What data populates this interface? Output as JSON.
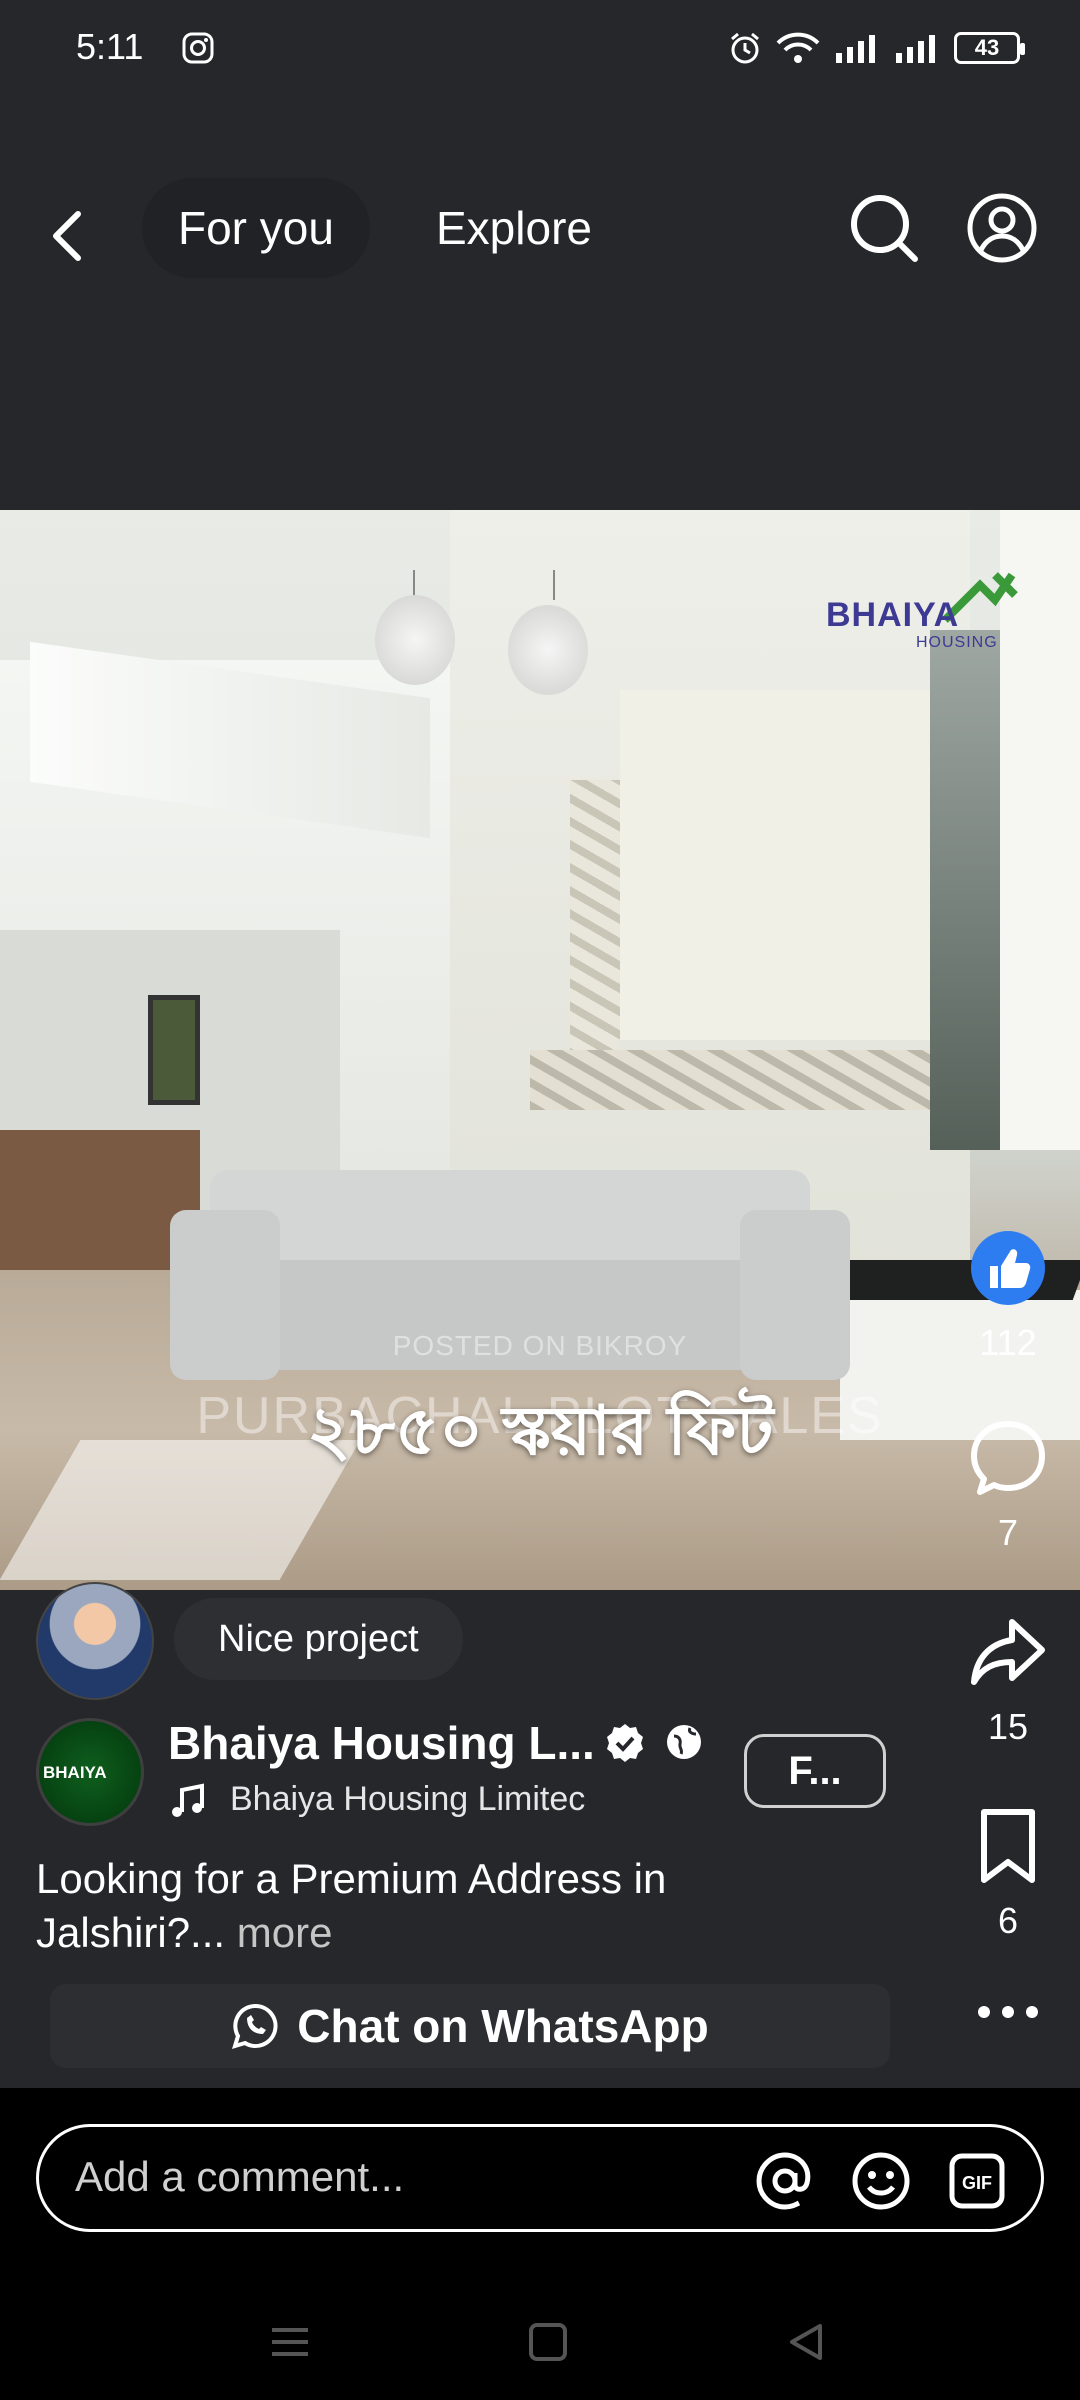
{
  "status_bar": {
    "time": "5:11",
    "battery": "43",
    "icons": [
      "instagram-icon",
      "alarm-icon",
      "wifi-icon",
      "signal-icon",
      "signal-icon",
      "battery-icon"
    ]
  },
  "nav": {
    "tabs": [
      {
        "label": "For you",
        "active": true
      },
      {
        "label": "Explore",
        "active": false
      }
    ],
    "icons": [
      "back-arrow-icon",
      "search-icon",
      "profile-icon"
    ]
  },
  "video": {
    "brand_logo": "BHAIYA",
    "brand_sub": "HOUSING",
    "watermark": "POSTED ON BIKROY",
    "caption_bn": "২৮৫০ স্কয়ার ফিট",
    "overlay_text": "PURBACHAL PLOT SALES"
  },
  "actions": {
    "likes": "112",
    "comments": "7",
    "shares": "15",
    "saves": "6"
  },
  "top_comment": "Nice project",
  "account": {
    "name": "Bhaiya Housing L...",
    "music": "Bhaiya Housing Limitec",
    "follow_label": "F...",
    "avatar_text": "BHAIYA"
  },
  "description": {
    "text": "Looking for a Premium Address in Jalshiri?...",
    "more": "more"
  },
  "whatsapp": {
    "label": "Chat on WhatsApp"
  },
  "comment_input": {
    "placeholder": "Add a comment..."
  },
  "colors": {
    "background": "#26272b",
    "like_blue": "#2d7df0",
    "brand": "#3d3a93"
  }
}
